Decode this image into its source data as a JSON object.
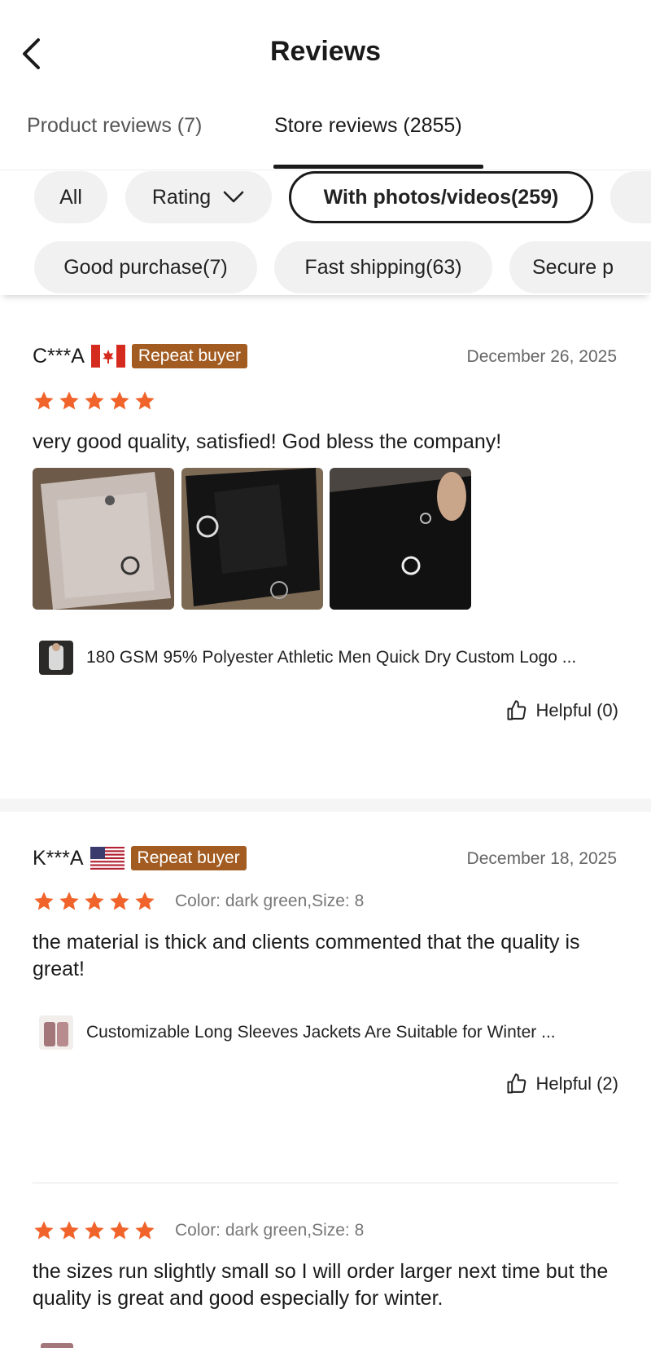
{
  "header": {
    "title": "Reviews",
    "back_icon": "chevron-left-icon"
  },
  "tabs": [
    {
      "label": "Product reviews (7)",
      "active": false
    },
    {
      "label": "Store reviews (2855)",
      "active": true
    }
  ],
  "filters": {
    "row1": [
      {
        "label": "All",
        "selected": false
      },
      {
        "label": "Rating",
        "selected": false,
        "icon": "chevron-down-icon"
      },
      {
        "label": "With photos/videos(259)",
        "selected": true
      }
    ],
    "row2": [
      {
        "label": "Good purchase(7)"
      },
      {
        "label": "Fast shipping(63)"
      },
      {
        "label": "Secure p"
      }
    ]
  },
  "reviews": [
    {
      "reviewer": "C***A",
      "country": "Canada",
      "badge": "Repeat buyer",
      "date": "December 26, 2025",
      "rating": 5,
      "variant": "",
      "text": "very good quality, satisfied! God bless the company!",
      "photo_count": 3,
      "product": "180 GSM 95% Polyester Athletic Men Quick Dry Custom Logo ...",
      "helpful": "Helpful (0)"
    },
    {
      "reviewer": "K***A",
      "country": "United States",
      "badge": "Repeat buyer",
      "date": "December 18, 2025",
      "rating": 5,
      "variant": "Color: dark green,Size: 8",
      "text": "the material is thick and clients commented that the quality is great!",
      "product": "Customizable Long Sleeves Jackets Are Suitable for Winter ...",
      "helpful": "Helpful (2)"
    },
    {
      "rating": 5,
      "variant": "Color: dark green,Size: 8",
      "text": "the sizes run slightly small so I will order larger next time but the quality is great and good especially for winter."
    }
  ],
  "colors": {
    "star": "#f0632a",
    "badge": "#a25c22",
    "text": "#1a1a1a",
    "muted": "#666666"
  }
}
